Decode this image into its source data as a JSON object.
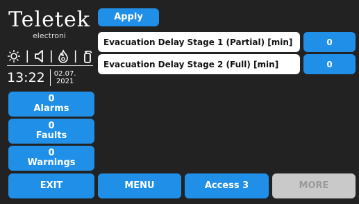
{
  "brand": {
    "name": "Teletek",
    "sub": "electroni"
  },
  "status_icons": [
    "sun-icon",
    "speaker-icon",
    "fire-icon",
    "fire-extinguisher-icon"
  ],
  "clock": {
    "time": "13:22",
    "date_line1": "02.07.",
    "date_line2": "2021"
  },
  "apply_label": "Apply",
  "settings": [
    {
      "label": "Evacuation Delay Stage 1 (Partial) [min]",
      "value": "0"
    },
    {
      "label": "Evacuation Delay Stage 2 (Full) [min]",
      "value": "0"
    }
  ],
  "counters": [
    {
      "count": "0",
      "label": "Alarms"
    },
    {
      "count": "0",
      "label": "Faults"
    },
    {
      "count": "0",
      "label": "Warnings"
    }
  ],
  "footer": {
    "exit": "EXIT",
    "menu": "MENU",
    "access": "Access 3",
    "more": "MORE"
  },
  "colors": {
    "accent": "#1f8fe8",
    "background": "#222222",
    "disabled": "#c9c9c9"
  }
}
